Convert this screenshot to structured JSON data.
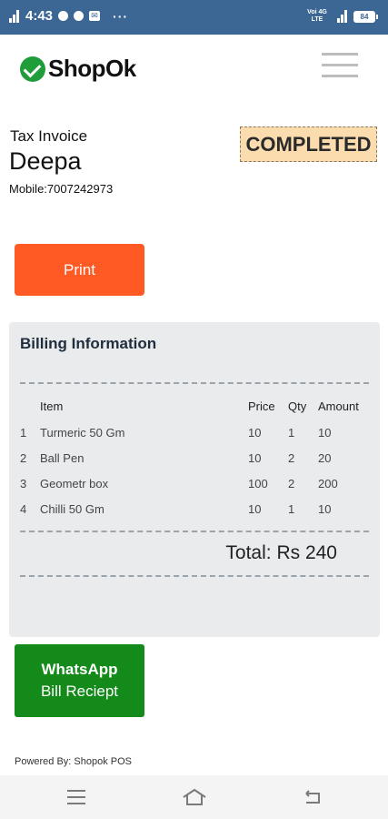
{
  "statusbar": {
    "time": "4:43",
    "more": "···",
    "lte": "Voi 4G LTE",
    "battery": "84"
  },
  "header": {
    "logo_text": "ShopOk"
  },
  "invoice": {
    "tax_label": "Tax Invoice",
    "customer_name": "Deepa",
    "mobile": "Mobile:7007242973",
    "status": "COMPLETED",
    "print_label": "Print"
  },
  "billing": {
    "title": "Billing Information",
    "columns": {
      "item": "Item",
      "price": "Price",
      "qty": "Qty",
      "amount": "Amount"
    },
    "rows": [
      {
        "no": "1",
        "item": "Turmeric 50 Gm",
        "price": "10",
        "qty": "1",
        "amount": "10"
      },
      {
        "no": "2",
        "item": "Ball Pen",
        "price": "10",
        "qty": "2",
        "amount": "20"
      },
      {
        "no": "3",
        "item": "Geometr box",
        "price": "100",
        "qty": "2",
        "amount": "200"
      },
      {
        "no": "4",
        "item": "Chilli 50 Gm",
        "price": "10",
        "qty": "1",
        "amount": "10"
      }
    ],
    "total": "Total: Rs 240"
  },
  "whatsapp": {
    "line1": "WhatsApp",
    "line2": "Bill Reciept"
  },
  "footer": {
    "powered_by": "Powered By: Shopok POS"
  },
  "colors": {
    "statusbar": "#3c6795",
    "print_button": "#ff5a23",
    "whatsapp_button": "#148a1a",
    "status_badge": "#fbdcae",
    "card_bg": "#e9ebed"
  }
}
